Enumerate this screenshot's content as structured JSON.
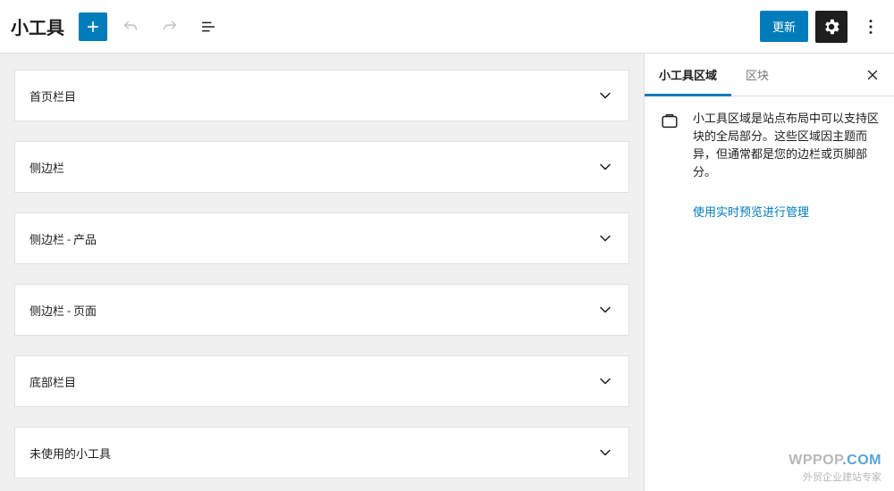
{
  "header": {
    "title": "小工具",
    "update_label": "更新"
  },
  "widget_areas": [
    {
      "label": "首页栏目"
    },
    {
      "label": "侧边栏"
    },
    {
      "label": "侧边栏 - 产品"
    },
    {
      "label": "侧边栏 - 页面"
    },
    {
      "label": "底部栏目"
    },
    {
      "label": "未使用的小工具"
    }
  ],
  "sidebar": {
    "tabs": {
      "areas": "小工具区域",
      "blocks": "区块"
    },
    "description": "小工具区域是站点布局中可以支持区块的全局部分。这些区域因主题而异，但通常都是您的边栏或页脚部分。",
    "link_label": "使用实时预览进行管理"
  },
  "watermark": {
    "brand_main": "WPPOP",
    "brand_accent": ".COM",
    "subtitle": "外贸企业建站专家"
  }
}
